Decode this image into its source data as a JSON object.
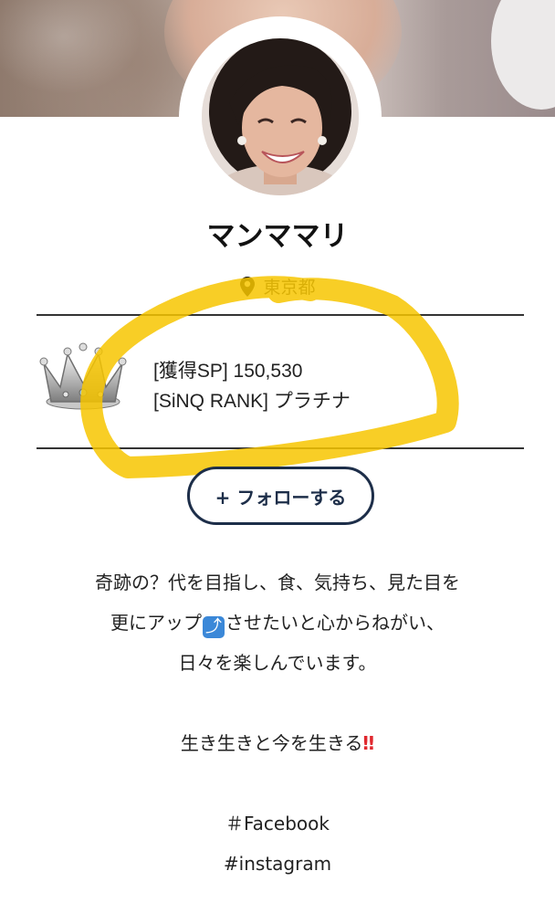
{
  "profile": {
    "name": "マンママリ",
    "location": "東京都"
  },
  "stats": {
    "sp_line": "[獲得SP] 150,530",
    "rank_line": "[SiNQ RANK] プラチナ"
  },
  "follow_button": {
    "label": "+ フォローする"
  },
  "bio": {
    "line1": "奇跡の？代を目指し、食、気持ち、見た目を",
    "line2_before": "更にアップ",
    "line2_emoji": "⤴",
    "line2_after": "させたいと心からねがい、",
    "line3": "日々を楽しんでいます。",
    "line4_text": "生き生きと今を生きる",
    "line4_emoji": "‼",
    "tag1": "＃Facebook",
    "tag2": "#instagram"
  },
  "colors": {
    "button_border": "#1d2e49",
    "highlight": "#f7c600",
    "divider": "#333333",
    "emoji_blue": "#3b88d8",
    "emoji_red": "#e0282e"
  },
  "icons": {
    "location": "map-pin-icon",
    "rank": "crown-icon"
  }
}
